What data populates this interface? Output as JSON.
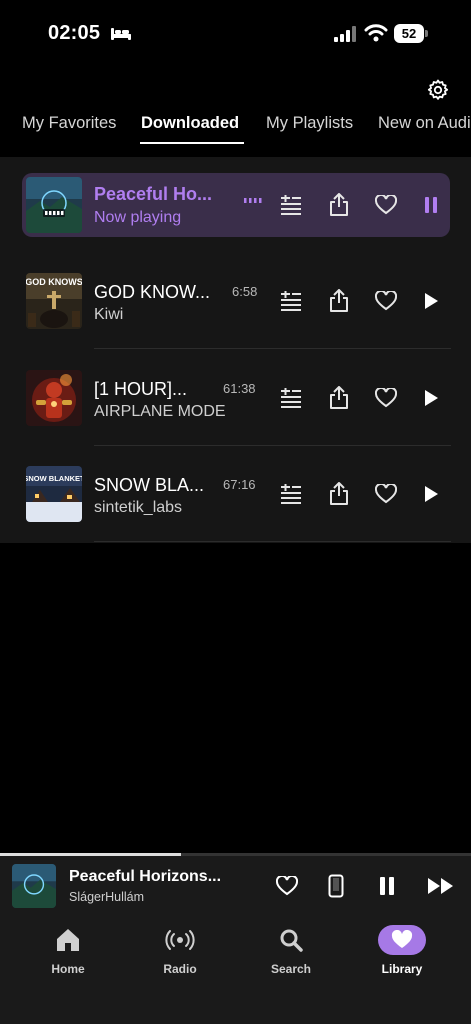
{
  "status_bar": {
    "time": "02:05",
    "battery": "52"
  },
  "tabs": [
    {
      "label": "My Favorites"
    },
    {
      "label": "Downloaded"
    },
    {
      "label": "My Playlists"
    },
    {
      "label": "New on Audi"
    }
  ],
  "tracks": [
    {
      "title": "Peaceful Ho...",
      "subtitle": "Now playing",
      "state": "playing",
      "icons": [
        "add-to-queue-icon",
        "share-icon",
        "heart-icon",
        "pause-icon"
      ]
    },
    {
      "title": "GOD KNOW...",
      "subtitle": "Kiwi",
      "duration": "6:58",
      "thumb_text": "GOD KNOWS",
      "icons": [
        "add-to-queue-icon",
        "share-icon",
        "heart-icon",
        "play-icon"
      ]
    },
    {
      "title": "[1 HOUR]...",
      "subtitle": "AIRPLANE MODE",
      "duration": "61:38",
      "icons": [
        "add-to-queue-icon",
        "share-icon",
        "heart-icon",
        "play-icon"
      ]
    },
    {
      "title": "SNOW BLA...",
      "subtitle": "sintetik_labs",
      "duration": "67:16",
      "thumb_text": "SNOW BLANKET",
      "icons": [
        "add-to-queue-icon",
        "share-icon",
        "heart-icon",
        "play-icon"
      ]
    }
  ],
  "mini_player": {
    "title": "Peaceful Horizons...",
    "subtitle": "SlágerHullám",
    "progress": 0.385,
    "icons": [
      "heart-icon",
      "device-icon",
      "pause-icon",
      "fast-forward-icon"
    ]
  },
  "bottom_nav": [
    {
      "label": "Home",
      "icon": "home-icon"
    },
    {
      "label": "Radio",
      "icon": "radio-icon"
    },
    {
      "label": "Search",
      "icon": "search-icon"
    },
    {
      "label": "Library",
      "icon": "heart-icon",
      "active": true
    }
  ],
  "colors": {
    "accent": "#b07ef0",
    "playing_row": "#3a2e4a",
    "library_pill": "#a679e6"
  }
}
